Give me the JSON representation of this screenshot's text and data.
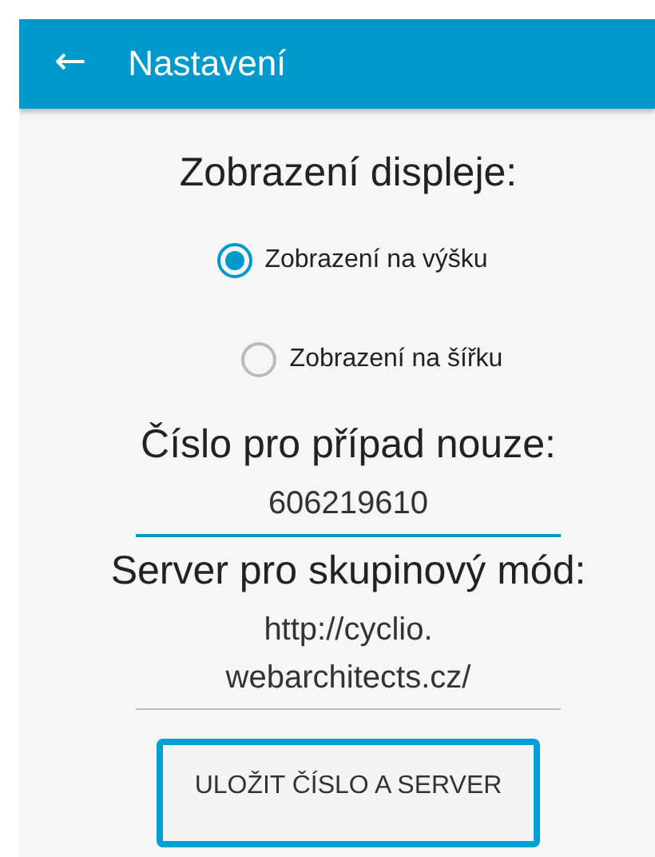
{
  "app_bar": {
    "back": "←",
    "title": "Nastavení"
  },
  "sections": [
    {
      "kind": "radios",
      "heading": "Zobrazení displeje:",
      "options": [
        {
          "label": "Zobrazení na výšku",
          "selected": true
        },
        {
          "label": "Zobrazení na šířku",
          "selected": false
        }
      ]
    },
    {
      "kind": "field",
      "heading": "Číslo pro případ nouze:",
      "value": "606219610",
      "focused": true
    },
    {
      "kind": "field",
      "heading": "Server pro skupinový mód:",
      "value": "http://cyclio.\nwebarchitects.cz/",
      "focused": false
    }
  ],
  "button": {
    "label": "ULOŽIT ČÍSLO A SERVER",
    "focused": true
  }
}
